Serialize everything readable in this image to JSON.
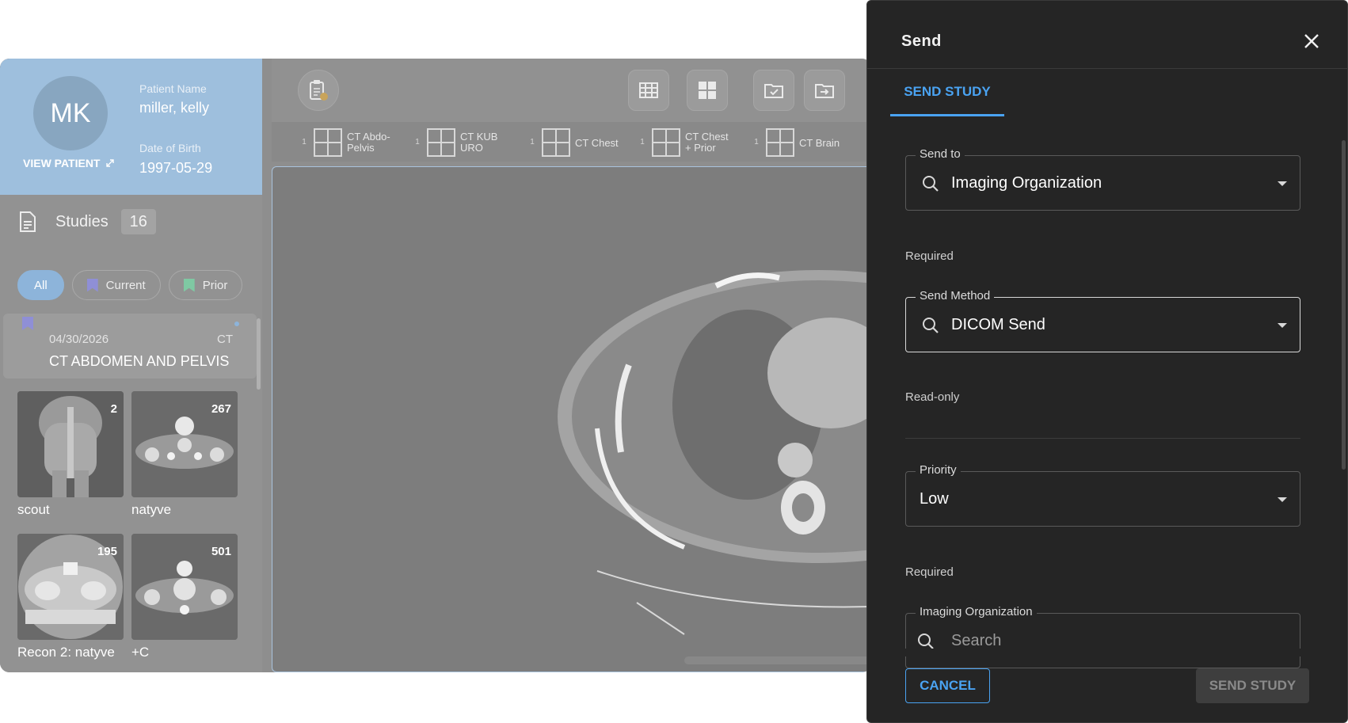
{
  "patient": {
    "initials": "MK",
    "view_patient_label": "VIEW PATIENT",
    "name_label": "Patient Name",
    "name": "miller, kelly",
    "dob_label": "Date of Birth",
    "dob": "1997-05-29"
  },
  "studies": {
    "label": "Studies",
    "count": "16",
    "filters": [
      {
        "label": "All",
        "active": true
      },
      {
        "label": "Current",
        "active": false
      },
      {
        "label": "Prior",
        "active": false
      }
    ],
    "current": {
      "date": "04/30/2026",
      "modality": "CT",
      "title": "CT ABDOMEN AND PELVIS"
    },
    "series": [
      {
        "label": "scout",
        "count": "2"
      },
      {
        "label": "natyve",
        "count": "267"
      },
      {
        "label": "Recon 2: natyve",
        "count": "195"
      },
      {
        "label": "+C",
        "count": "501"
      }
    ]
  },
  "protocols": [
    {
      "num": "1",
      "line1": "CT Abdo-",
      "line2": "Pelvis"
    },
    {
      "num": "1",
      "line1": "CT KUB",
      "line2": "URO"
    },
    {
      "num": "1",
      "line1": "CT Chest",
      "line2": ""
    },
    {
      "num": "1",
      "line1": "CT Chest",
      "line2": "+ Prior"
    },
    {
      "num": "1",
      "line1": "CT Brain",
      "line2": ""
    }
  ],
  "colors": {
    "accent": "#4aa3f2",
    "current_bookmark": "#8f8fd6",
    "prior_bookmark": "#7fc9a3",
    "dialog_bg": "#252525"
  },
  "dialog": {
    "title": "Send",
    "tab": "SEND STUDY",
    "send_to": {
      "label": "Send to",
      "value": "Imaging Organization",
      "helper": "Required"
    },
    "send_method": {
      "label": "Send Method",
      "value": "DICOM Send",
      "helper": "Read-only"
    },
    "priority": {
      "label": "Priority",
      "value": "Low",
      "helper": "Required"
    },
    "imaging_org": {
      "label": "Imaging Organization",
      "placeholder": "Search"
    },
    "cancel_label": "CANCEL",
    "send_label": "SEND STUDY"
  }
}
